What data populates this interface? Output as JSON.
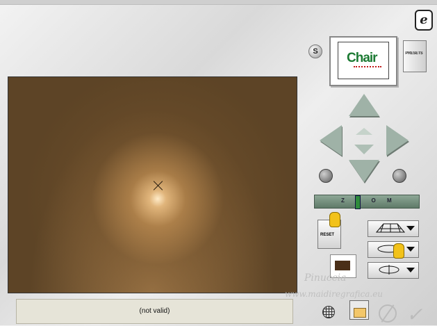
{
  "logo": {
    "glyph": "e"
  },
  "s_button": {
    "label": "S"
  },
  "preset_preview": {
    "text": "Chair"
  },
  "presets_button": {
    "label": "PRESETS"
  },
  "zoom": {
    "label": "Z O O M",
    "level": 0.4
  },
  "reset_button": {
    "label": "RESET"
  },
  "status": {
    "text": "(not valid)"
  },
  "watermark": {
    "line1": "Pinuccia",
    "line2": "www.maidiregrafica.eu"
  },
  "colors": {
    "preview_dark": "#5d4426",
    "preview_light": "#ffe9c8",
    "arrow": "#9fb2a7"
  },
  "icons": [
    "eye-candy-logo-icon",
    "grid-icon",
    "folder-icon",
    "cancel-icon",
    "ok-check-icon",
    "hand-pointer-icon"
  ]
}
